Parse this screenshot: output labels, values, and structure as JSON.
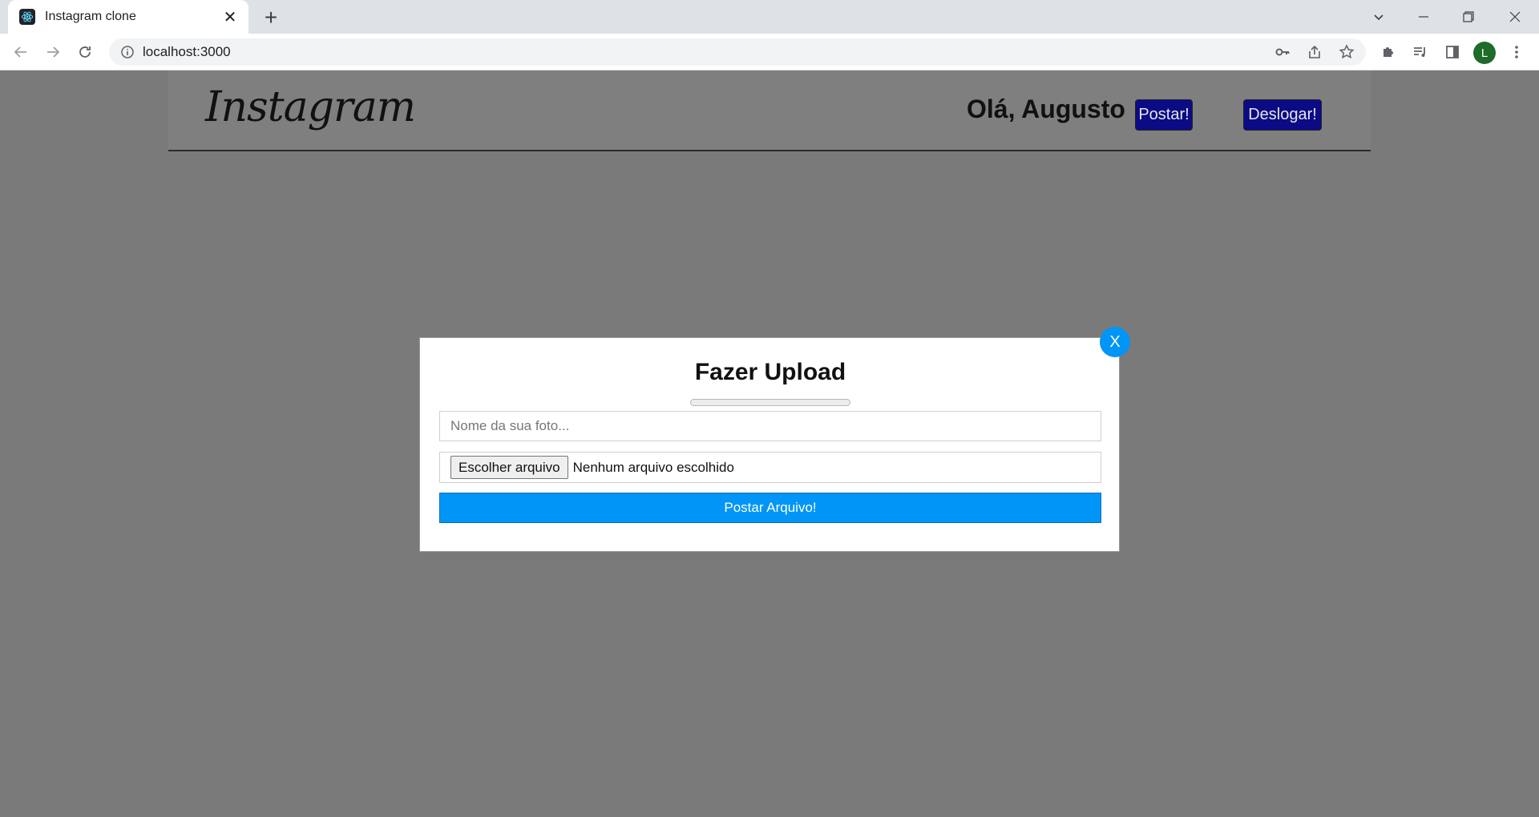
{
  "browser": {
    "tab_title": "Instagram clone",
    "tab_close": "✕",
    "new_tab": "+",
    "url": "localhost:3000",
    "profile_initial": "L"
  },
  "header": {
    "logo_text": "Instagram",
    "greeting": "Olá, Augusto",
    "post_button": "Postar!",
    "logout_button": "Deslogar!"
  },
  "modal": {
    "close_label": "X",
    "title": "Fazer Upload",
    "progress_percent": 0,
    "name_placeholder": "Nome da sua foto...",
    "name_value": "",
    "file_button": "Escolher arquivo",
    "file_status": "Nenhum arquivo escolhido",
    "submit_label": "Postar Arquivo!"
  },
  "colors": {
    "overlay": "#7a7a7a",
    "accent_blue": "#0095f6",
    "header_button_bg": "#0b0b86"
  }
}
